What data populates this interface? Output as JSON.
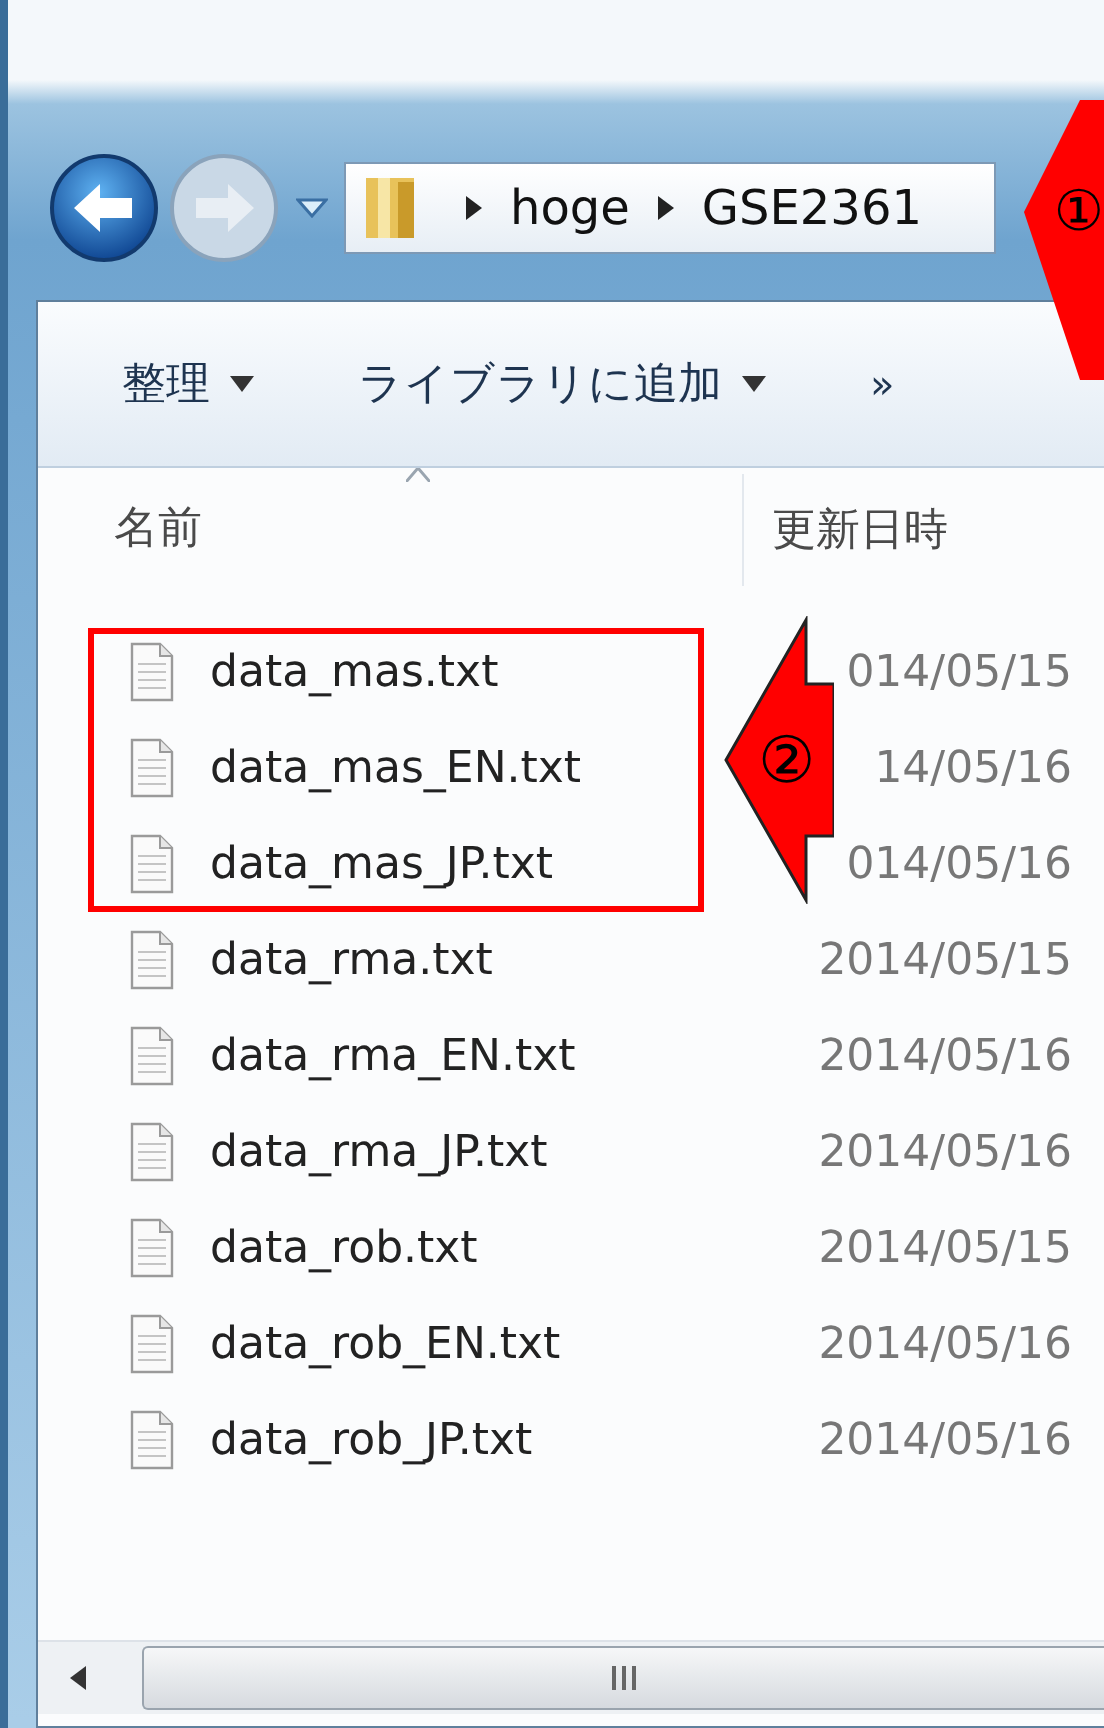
{
  "navigation": {
    "path": [
      "hoge",
      "GSE2361"
    ]
  },
  "toolbar": [
    {
      "label": "整理",
      "kind": "menu"
    },
    {
      "label": "ライブラリに追加",
      "kind": "menu"
    },
    {
      "label": "»",
      "kind": "more"
    }
  ],
  "table": {
    "columns": [
      "名前",
      "更新日時"
    ],
    "rows": [
      {
        "name": "data_mas.txt",
        "modified": "014/05/15",
        "boxed": true
      },
      {
        "name": "data_mas_EN.txt",
        "modified": "14/05/16",
        "boxed": true
      },
      {
        "name": "data_mas_JP.txt",
        "modified": "014/05/16",
        "boxed": true
      },
      {
        "name": "data_rma.txt",
        "modified": "2014/05/15",
        "boxed": false
      },
      {
        "name": "data_rma_EN.txt",
        "modified": "2014/05/16",
        "boxed": false
      },
      {
        "name": "data_rma_JP.txt",
        "modified": "2014/05/16",
        "boxed": false
      },
      {
        "name": "data_rob.txt",
        "modified": "2014/05/15",
        "boxed": false
      },
      {
        "name": "data_rob_EN.txt",
        "modified": "2014/05/16",
        "boxed": false
      },
      {
        "name": "data_rob_JP.txt",
        "modified": "2014/05/16",
        "boxed": false
      }
    ]
  },
  "callouts": [
    {
      "label": "①",
      "kind": "path"
    },
    {
      "label": "②",
      "kind": "files"
    }
  ]
}
